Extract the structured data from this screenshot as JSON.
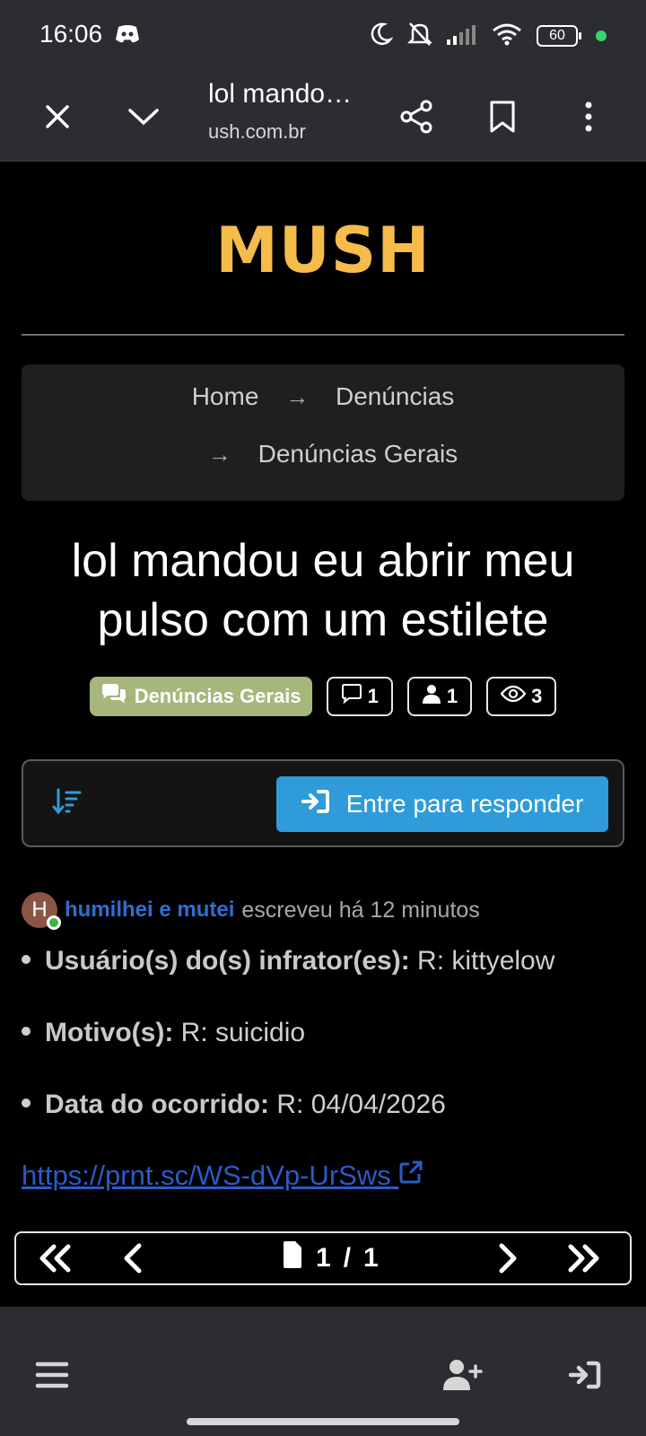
{
  "status_bar": {
    "time": "16:06",
    "battery": "60",
    "icons": [
      "discord-icon",
      "moon-icon",
      "bell-off-icon",
      "signal-icon",
      "wifi-icon",
      "battery-icon"
    ]
  },
  "browser": {
    "title": "lol mando…",
    "domain": "ush.com.br",
    "icons": [
      "close-icon",
      "chevron-down-icon",
      "share-icon",
      "bookmark-icon",
      "more-vert-icon"
    ]
  },
  "site": {
    "logo": "MUSH",
    "logo_color": "#f5bc4b"
  },
  "breadcrumb": {
    "items": [
      "Home",
      "Denúncias",
      "Denúncias Gerais"
    ],
    "separator": "→"
  },
  "topic": {
    "title": "lol mandou eu abrir meu pulso com um estilete",
    "category": "Denúncias Gerais",
    "category_color": "#a5b77a",
    "replies": "1",
    "posters": "1",
    "views": "3"
  },
  "actions": {
    "reply_label": "Entre para responder",
    "reply_color": "#2f9bd9"
  },
  "post": {
    "avatar_letter": "H",
    "author": "humilhei e mutei",
    "meta": "escreveu há 12 minutos",
    "lines": [
      {
        "label": "Usuário(s) do(s) infrator(es):",
        "value": "R: kittyelow"
      },
      {
        "label": "Motivo(s):",
        "value": "R: suicidio"
      },
      {
        "label": "Data do ocorrido:",
        "value": "R: 04/04/2026"
      }
    ],
    "link": "https://prnt.sc/WS-dVp-UrSws"
  },
  "pagination": {
    "current": "1",
    "separator": "/",
    "total": "1"
  },
  "bottom_nav": {
    "icons": [
      "menu-icon",
      "register-icon",
      "login-icon"
    ]
  }
}
